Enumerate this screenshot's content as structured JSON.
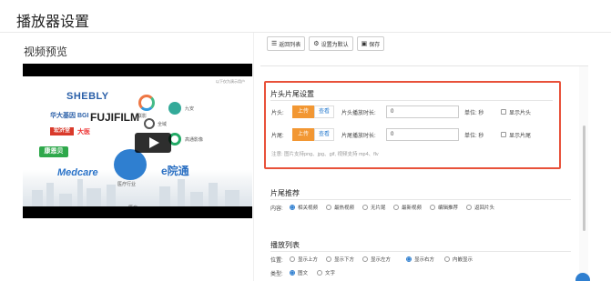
{
  "page": {
    "title": "播放器设置"
  },
  "preview": {
    "label": "视频预览",
    "caption_top": "以下仅为演示用户",
    "footer": "医疗",
    "logos": {
      "shebly": "SHEBLY",
      "huada": "华大基因 BGI",
      "fuji": "FUJIFILM",
      "red_box": "宏济堂",
      "dl": "大医",
      "green": "康恩贝",
      "medcare": "Medcare",
      "eyuan": "e院通",
      "lianying": "联影",
      "jiuan": "九安",
      "quanyi": "全域",
      "gaotong": "高通影像",
      "med_industry": "医疗行业"
    }
  },
  "toolbar": {
    "back": "返回列表",
    "default": "设置为默认",
    "save": "保存"
  },
  "head_tail": {
    "title": "片头片尾设置",
    "head_label": "片头:",
    "tail_label": "片尾:",
    "upload": "上传",
    "view": "查看",
    "head_duration_label": "片头播放时长:",
    "tail_duration_label": "片尾播放时长:",
    "head_duration": "0",
    "tail_duration": "0",
    "unit": "单位: 秒",
    "show_head": "显示片头",
    "show_tail": "显示片尾",
    "note": "注意: 图片支持png、jpg、gif, 视频支持 mp4、flv"
  },
  "recommend": {
    "title": "片尾推荐",
    "label": "内容:",
    "options": [
      "相关视频",
      "最热视频",
      "无片尾",
      "最新视频",
      "编辑推荐",
      "返回片头"
    ],
    "selected": 0
  },
  "playlist": {
    "title": "播放列表",
    "position_label": "位置:",
    "positions": [
      "显示上方",
      "显示下方",
      "显示左方",
      "显示右方",
      "内嵌显示"
    ],
    "position_selected": 3,
    "type_label": "类型:",
    "types": [
      "图文",
      "文字"
    ],
    "type_selected": 0
  },
  "colors": {
    "accent": "#f29733",
    "highlight": "#e8513a",
    "link": "#2f7fd0"
  }
}
